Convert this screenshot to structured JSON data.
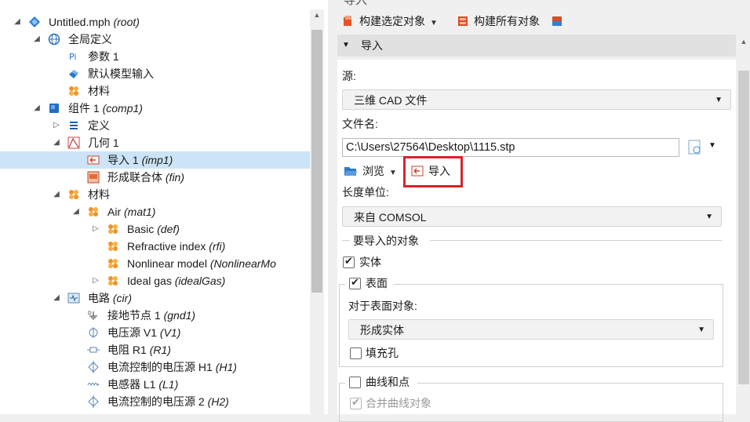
{
  "tree": {
    "items": [
      {
        "label": "Untitled.mph",
        "id": "(root)",
        "icon": "model-file-icon",
        "depth": 0,
        "toggle": "▲"
      },
      {
        "label": "全局定义",
        "id": "",
        "icon": "globe-icon",
        "depth": 1,
        "toggle": "▲"
      },
      {
        "label": "参数 1",
        "id": "",
        "icon": "parameter-pi-icon",
        "depth": 2,
        "toggle": ""
      },
      {
        "label": "默认模型输入",
        "id": "",
        "icon": "model-input-icon",
        "depth": 2,
        "toggle": ""
      },
      {
        "label": "材料",
        "id": "",
        "icon": "materials-icon",
        "depth": 2,
        "toggle": ""
      },
      {
        "label": "组件 1",
        "id": "(comp1)",
        "icon": "component-icon",
        "depth": 1,
        "toggle": "▲"
      },
      {
        "label": "定义",
        "id": "",
        "icon": "definitions-icon",
        "depth": 2,
        "toggle": "▷"
      },
      {
        "label": "几何 1",
        "id": "",
        "icon": "geometry-icon",
        "depth": 2,
        "toggle": "▲"
      },
      {
        "label": "导入 1",
        "id": "(imp1)",
        "icon": "import-icon",
        "depth": 3,
        "toggle": "",
        "selected": true
      },
      {
        "label": "形成联合体",
        "id": "(fin)",
        "icon": "form-union-icon",
        "depth": 3,
        "toggle": ""
      },
      {
        "label": "材料",
        "id": "",
        "icon": "materials-icon",
        "depth": 2,
        "toggle": "▲"
      },
      {
        "label": "Air",
        "id": "(mat1)",
        "icon": "material-icon",
        "depth": 3,
        "toggle": "▲"
      },
      {
        "label": "Basic",
        "id": "(def)",
        "icon": "material-property-icon",
        "depth": 4,
        "toggle": "▷"
      },
      {
        "label": "Refractive index",
        "id": "(rfi)",
        "icon": "material-property-icon",
        "depth": 4,
        "toggle": ""
      },
      {
        "label": "Nonlinear model",
        "id": "(NonlinearMo",
        "icon": "material-property-icon",
        "depth": 4,
        "toggle": ""
      },
      {
        "label": "Ideal gas",
        "id": "(idealGas)",
        "icon": "material-property-icon",
        "depth": 4,
        "toggle": "▷"
      },
      {
        "label": "电路",
        "id": "(cir)",
        "icon": "circuit-icon",
        "depth": 2,
        "toggle": "▲"
      },
      {
        "label": "接地节点 1",
        "id": "(gnd1)",
        "icon": "ground-node-icon",
        "depth": 3,
        "toggle": ""
      },
      {
        "label": "电压源 V1",
        "id": "(V1)",
        "icon": "voltage-source-icon",
        "depth": 3,
        "toggle": ""
      },
      {
        "label": "电阻 R1",
        "id": "(R1)",
        "icon": "resistor-icon",
        "depth": 3,
        "toggle": ""
      },
      {
        "label": "电流控制的电压源 H1",
        "id": "(H1)",
        "icon": "ccvs-icon",
        "depth": 3,
        "toggle": ""
      },
      {
        "label": "电感器 L1",
        "id": "(L1)",
        "icon": "inductor-icon",
        "depth": 3,
        "toggle": ""
      },
      {
        "label": "电流控制的电压源 2",
        "id": "(H2)",
        "icon": "ccvs-icon",
        "depth": 3,
        "toggle": ""
      }
    ]
  },
  "settings": {
    "window_title": "导入",
    "toolbar": {
      "build_selected": "构建选定对象",
      "build_all": "构建所有对象"
    },
    "section_title": "导入",
    "source_label": "源:",
    "source_value": "三维 CAD 文件",
    "filename_label": "文件名:",
    "filename_value": "C:\\Users\\27564\\Desktop\\1115.stp",
    "browse_label": "浏览",
    "import_label": "导入",
    "length_unit_label": "长度单位:",
    "length_unit_value": "来自 COMSOL",
    "objects_group_label": "要导入的对象",
    "solids_label": "实体",
    "solids_checked": true,
    "surfaces_label": "表面",
    "surfaces_checked": true,
    "surface_objects_label": "对于表面对象:",
    "surface_objects_value": "形成实体",
    "fill_holes_label": "填充孔",
    "fill_holes_checked": false,
    "curves_points_label": "曲线和点",
    "curves_points_checked": false,
    "merge_curves_label": "合并曲线对象",
    "merge_curves_checked": true
  },
  "colors": {
    "selection": "#cce4f7",
    "highlight_box": "#d9232b",
    "folder_blue": "#1f6fc5",
    "material_orange": "#f0932b"
  }
}
